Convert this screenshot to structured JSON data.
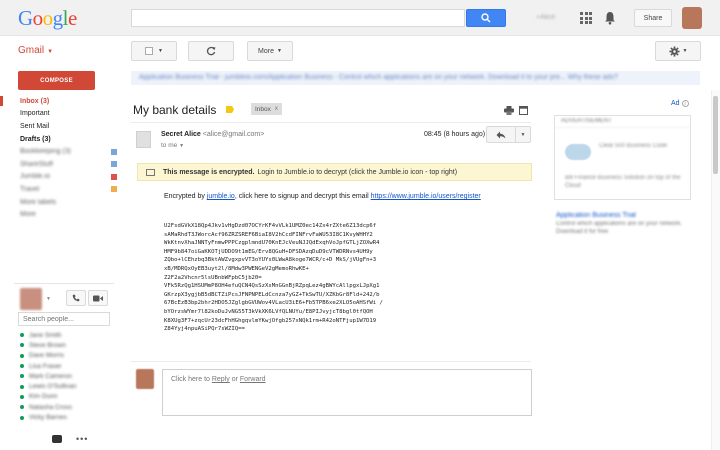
{
  "header": {
    "logo_letters": [
      "G",
      "o",
      "o",
      "g",
      "l",
      "e"
    ],
    "search_placeholder": "",
    "user_label": "+Alice",
    "share_label": "Share"
  },
  "toolbar": {
    "gmail_label": "Gmail",
    "more_label": "More"
  },
  "promo_text": "Application Business Trial - jumbleio.com/Application Business - Control which applications are on your network. Download it to your pre... Why these ads?",
  "sidebar": {
    "compose_label": "COMPOSE",
    "items": [
      {
        "label": "Inbox (3)",
        "state": "active"
      },
      {
        "label": "Important",
        "state": "normal"
      },
      {
        "label": "Sent Mail",
        "state": "normal"
      },
      {
        "label": "Drafts (3)",
        "state": "bold"
      },
      {
        "label": "Bookkeeping (3)",
        "state": "blurred",
        "color": "#7aa7d8"
      },
      {
        "label": "ShareStuff",
        "state": "blurred",
        "color": "#7aa7d8"
      },
      {
        "label": "Jumble.io",
        "state": "blurred",
        "color": "#d9534f"
      },
      {
        "label": "Travel",
        "state": "blurred",
        "color": "#f0ad4e"
      },
      {
        "label": "More labels",
        "state": "blurred"
      },
      {
        "label": "More",
        "state": "blurred"
      }
    ]
  },
  "chat": {
    "search_placeholder": "Search people...",
    "contacts": [
      "Jane Smith",
      "Steve Brown",
      "Dave Morris",
      "Lisa Fraser",
      "Mark Cameron",
      "Lewis O'Sullivan",
      "Kim Dunn",
      "Natasha Cross",
      "Vicky Barnes"
    ]
  },
  "message": {
    "subject": "My bank details",
    "tag": "Inbox",
    "tag_close": "x",
    "sender_name": "Secret Alice",
    "sender_email": "<alice@gmail.com>",
    "to": "to me",
    "time": "08:45 (8 hours ago)",
    "banner_bold": "This message is encrypted.",
    "banner_rest": "Login to Jumble.io to decrypt (click the Jumble.io icon - top right)",
    "body_pre": "Encrypted by",
    "body_link1": "jumble.io",
    "body_mid": ", click here to signup and decrypt this email",
    "body_link2": "https://www.jumble.io/users/register",
    "cipher_lines": [
      "U2FsdGVkX18Qp4Jkv1vHgDzd07OCYrKF4vVLk1UMZ0ec14Zx4rZXte6Z13dcp6f",
      "sAMaRhdT3JWorcAcf96ZRZSREF6BiaI8V2hCcdFINFrvFaWU53I8C1KvyWHHY2",
      "WkKtnvXhaJNNTyFnmwPPPCzgplmndU70KnEJcVeuNJJQdExqhVoJpfGTLjZOXwR4",
      "HMF9b847oiGaKKOTjUDDO9t1mEG/Erv8QGuH+DFSDAzqDuD9cVTWDRNvs4UH9y",
      "ZQbo+lCEhzbq3BktAWZvgxpvVT3oYUYs0LWwA8koge7WCR/c+D MkS/jVUgFn+3",
      "xB/MDRQxOyEB3uyt2l/8Mdw3PWENGeV2gMemoRhwKE+",
      "Z2F2a2Vhcnr5lsUBnbWFpbC5jb20=",
      "VFk5RzQg1HSUMmP8OH4efuQCN4QsSzXsMnGGnBjRZpqLez4gBWYcAllpgxLJpXg1",
      "GKrzpX3ygjbB5dBCTZiPcsJFNPNPELdCcnza7yGZ+TkSwTU/XZKbGr8Fld+242/b",
      "67BcEzB3bp2bhr2HDO5JZglgbGVUWov4VLacU3iE6+Fb5TPB6xe2XLO5oAHSfWi /",
      "bYOrzsWYmr7l82koDuJvNG55T3kVkXK6LVfQLNUYu/E8PIJvyjcT8bgl0tfQOH",
      "K8XUg3F7+zqcUr23dcFhHGhgqvlmYKwjOfgb257xNQk1rm+R42oNTFjup1W7D19",
      "Z84Yyj4npuASiPQr7sWZIQ=="
    ],
    "reply_pre": "Click here to",
    "reply_link": "Reply",
    "reply_mid": "or",
    "forward_link": "Forward"
  },
  "right_panel": {
    "ad_label": "Ad",
    "card_header": "ADVERTISEMENT",
    "card_title": "Clear 500 Business Code",
    "card_text": "Bill Finance Business Solution on top of the Cloud",
    "link": "Application Business Trial",
    "desc": "Control which applications are on your network. Download it for free"
  }
}
